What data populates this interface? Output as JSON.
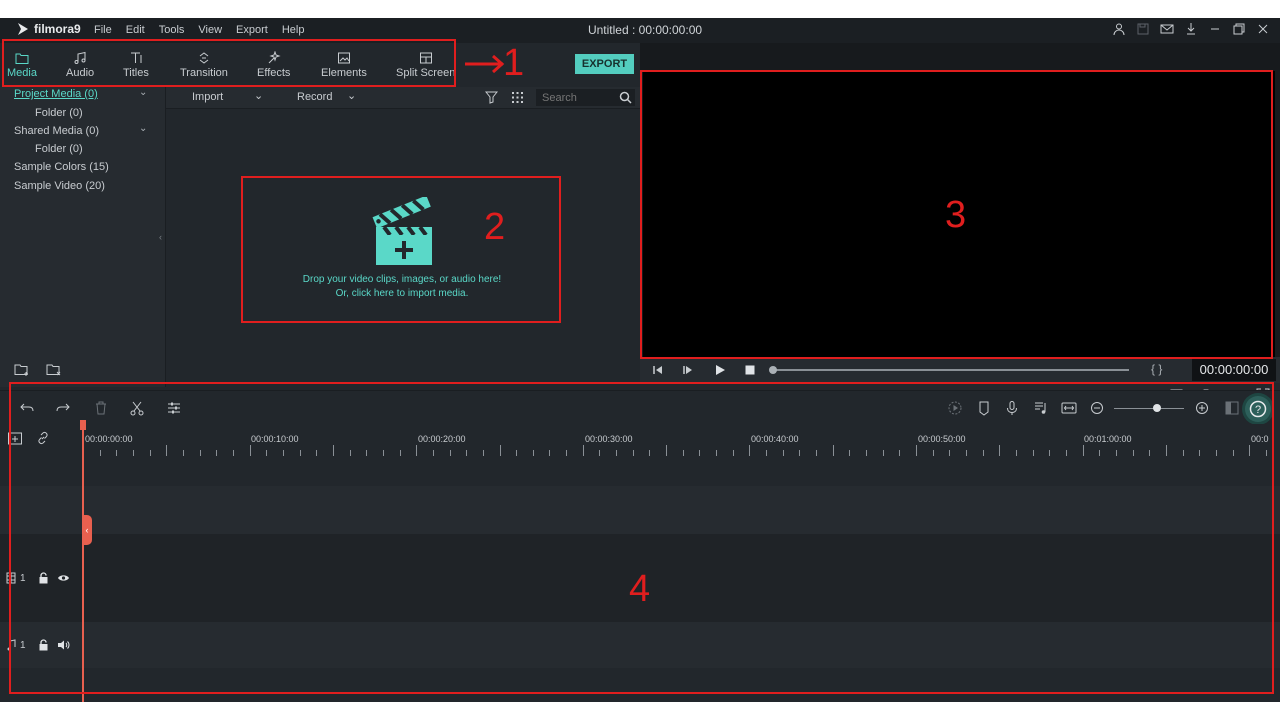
{
  "app": {
    "logo_text": "filmora9",
    "menu": [
      "File",
      "Edit",
      "Tools",
      "View",
      "Export",
      "Help"
    ],
    "window_title": "Untitled : 00:00:00:00"
  },
  "toolbar": {
    "tabs": [
      {
        "label": "Media",
        "icon": "folder-icon"
      },
      {
        "label": "Audio",
        "icon": "music-note-icon"
      },
      {
        "label": "Titles",
        "icon": "text-icon"
      },
      {
        "label": "Transition",
        "icon": "transition-icon"
      },
      {
        "label": "Effects",
        "icon": "effects-icon"
      },
      {
        "label": "Elements",
        "icon": "image-icon"
      },
      {
        "label": "Split Screen",
        "icon": "split-screen-icon"
      }
    ],
    "active_tab": "Media",
    "export_label": "EXPORT"
  },
  "library": {
    "items": [
      {
        "label": "Project Media (0)"
      },
      {
        "label": "Folder (0)"
      },
      {
        "label": "Shared Media (0)"
      },
      {
        "label": "Folder (0)"
      },
      {
        "label": "Sample Colors (15)"
      },
      {
        "label": "Sample Video (20)"
      }
    ]
  },
  "media": {
    "import_label": "Import",
    "record_label": "Record",
    "search_placeholder": "Search",
    "drop_line1": "Drop your video clips, images, or audio here!",
    "drop_line2": "Or, click here to import media."
  },
  "preview": {
    "timecode": "00:00:00:00",
    "brackets": "{ }"
  },
  "timeline": {
    "ruler_labels": [
      "00:00:00:00",
      "00:00:10:00",
      "00:00:20:00",
      "00:00:30:00",
      "00:00:40:00",
      "00:00:50:00",
      "00:01:00:00",
      "00:0"
    ],
    "video_track_number": "1",
    "audio_track_number": "1",
    "help_label": "?"
  },
  "annotations": {
    "arrow": "→",
    "labels": [
      "1",
      "2",
      "3",
      "4"
    ],
    "color": "#e01e1e"
  },
  "colors": {
    "accent": "#53cdbf",
    "background": "#22272c",
    "playhead": "#e8604f"
  }
}
